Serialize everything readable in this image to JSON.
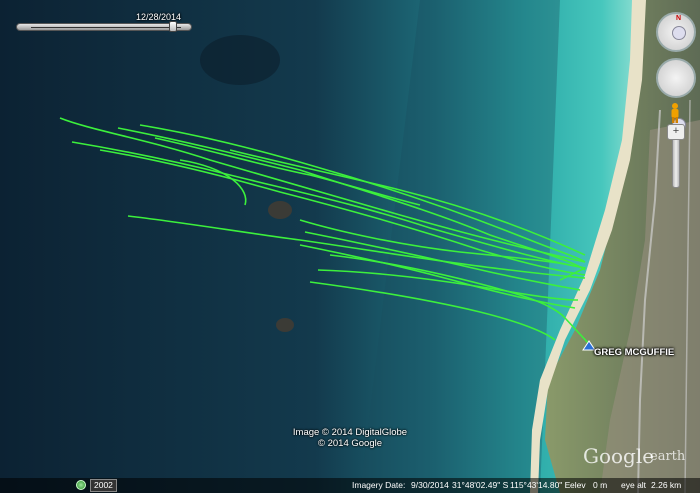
{
  "time_slider": {
    "date": "12/28/2014",
    "position": 0.92
  },
  "copyright": {
    "line1": "Image © 2014 DigitalGlobe",
    "line2": "© 2014 Google"
  },
  "placemark": {
    "label": "GREG MCGUFFIE"
  },
  "logo": {
    "text": "Google",
    "suffix": "earth"
  },
  "history": {
    "year": "2002",
    "icon": "historical-imagery-icon"
  },
  "status": {
    "imagery_date_label": "Imagery Date:",
    "imagery_date": "9/30/2014",
    "lat": "31°48'02.49\" S",
    "lon": "115°43'14.80\" E",
    "elev_label": "elev",
    "elev": "0 m",
    "eye_label": "eye alt",
    "eye_alt": "2.26 km"
  },
  "nav_controls": {
    "north_label": "N",
    "icons": [
      "look-ring-icon",
      "move-ring-icon",
      "pegman-icon",
      "zoom-slider-icon"
    ]
  },
  "colors": {
    "track": "#3cf03c",
    "sea_deep": "#0f2a3e",
    "sea_shallow": "#2fb3ae",
    "sand": "#e8e2c8"
  }
}
